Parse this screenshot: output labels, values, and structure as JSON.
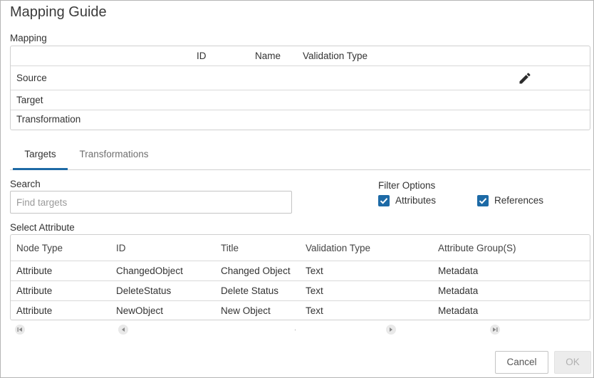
{
  "dialog": {
    "title": "Mapping Guide"
  },
  "mapping": {
    "label": "Mapping",
    "columns": [
      "ID",
      "Name",
      "Validation Type"
    ],
    "rows": [
      "Source",
      "Target",
      "Transformation"
    ],
    "edit_icon": "pencil-icon"
  },
  "tabs": [
    {
      "label": "Targets",
      "active": true
    },
    {
      "label": "Transformations",
      "active": false
    }
  ],
  "search": {
    "label": "Search",
    "placeholder": "Find targets",
    "value": ""
  },
  "filter": {
    "label": "Filter Options",
    "options": [
      {
        "label": "Attributes",
        "checked": true
      },
      {
        "label": "References",
        "checked": true
      }
    ]
  },
  "attributes": {
    "label": "Select Attribute",
    "columns": [
      "Node Type",
      "ID",
      "Title",
      "Validation Type",
      "Attribute Group(S)"
    ],
    "rows": [
      [
        "Attribute",
        "ChangedObject",
        "Changed Object",
        "Text",
        "Metadata"
      ],
      [
        "Attribute",
        "DeleteStatus",
        "Delete Status",
        "Text",
        "Metadata"
      ],
      [
        "Attribute",
        "NewObject",
        "New Object",
        "Text",
        "Metadata"
      ]
    ]
  },
  "scroll_controls": [
    "first-page-icon",
    "prev-icon",
    "next-icon",
    "last-page-icon"
  ],
  "buttons": {
    "cancel": "Cancel",
    "ok": "OK"
  },
  "colors": {
    "accent": "#1e6aa5",
    "checkbox": "#1d6aa6",
    "border": "#cfcfcf"
  }
}
